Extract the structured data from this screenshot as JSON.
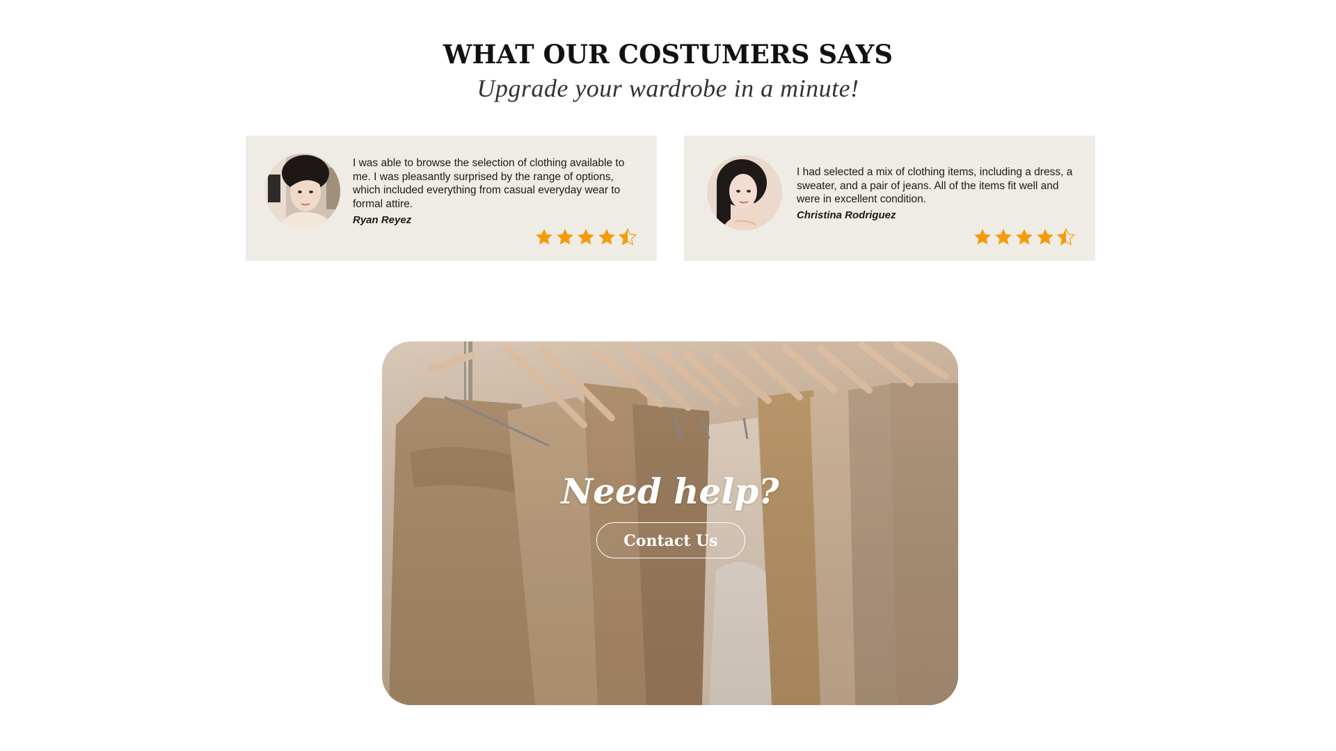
{
  "testimonials": {
    "title": "WHAT OUR COSTUMERS SAYS",
    "subtitle": "Upgrade your wardrobe in a minute!",
    "reviews": [
      {
        "text": "I was able to browse the selection of clothing available to me. I was pleasantly surprised by the range of options, which included everything from casual everyday wear to formal attire.",
        "name": "Ryan Reyez",
        "rating": 4.5
      },
      {
        "text": "I had selected a mix of clothing items, including a dress, a sweater, and a pair of jeans. All of the items fit well and were in excellent condition.",
        "name": "Christina Rodriguez",
        "rating": 4.5
      }
    ]
  },
  "help_banner": {
    "title": "Need help?",
    "button_label": "Contact Us"
  },
  "colors": {
    "card_background": "#efece6",
    "star": "#f59b0b",
    "banner_tone": "#c9a888"
  },
  "icons": {
    "rating_star": "star-icon",
    "rating_half_star": "half-star-icon"
  }
}
